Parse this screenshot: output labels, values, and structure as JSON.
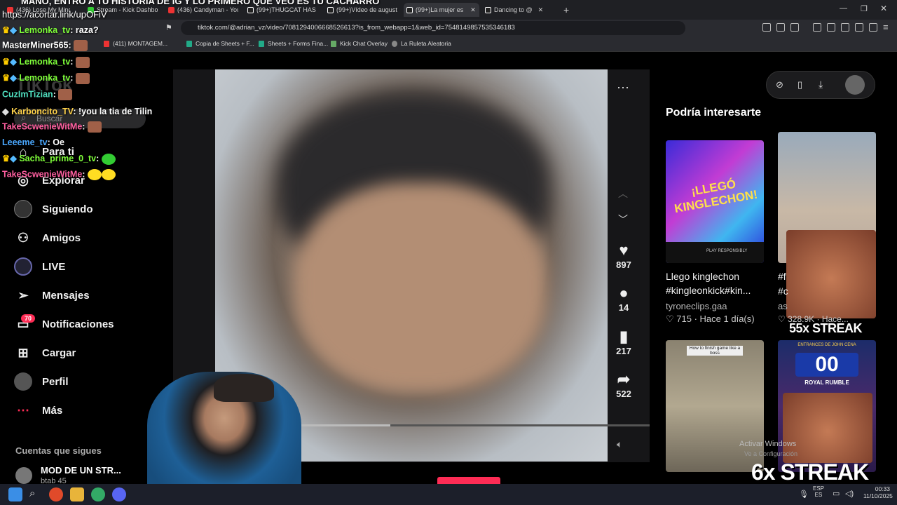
{
  "overlay": {
    "banner": "MANO, ENTRO A TU HISTORIA DE IG Y LO PRIMERO QUE VEO ES TU CACHARRO",
    "link": "https://acortar.link/upOFiV"
  },
  "tabs": [
    {
      "label": "(436) Lose My Mind",
      "color": "#e33"
    },
    {
      "label": "Stream - Kick Dashboa",
      "color": "#3c3"
    },
    {
      "label": "(436) Candyman - You",
      "color": "#e33"
    },
    {
      "label": "(99+)THUGCAT HAS B",
      "color": "#fff"
    },
    {
      "label": "(99+)Vídeo de auguste",
      "color": "#fff"
    },
    {
      "label": "(99+)La mujer es",
      "color": "#fff"
    },
    {
      "label": "Dancing to @",
      "color": "#fff"
    }
  ],
  "address": {
    "url": "tiktok.com/@adrian_vz/video/7081294006668526613?is_from_webapp=1&web_id=7548149857535346183"
  },
  "bookmarks": [
    {
      "label": "(411) MONTAGEM...",
      "color": "#e33"
    },
    {
      "label": "Copia de Sheets + F...",
      "color": "#2a8"
    },
    {
      "label": "Sheets + Forms Fina...",
      "color": "#2a8"
    },
    {
      "label": "Kick Chat Overlay",
      "color": "#6a6"
    },
    {
      "label": "La Ruleta Aleatoria",
      "color": "#888"
    }
  ],
  "sidebar": {
    "logo": "TikTok",
    "search_placeholder": "Buscar",
    "items": [
      {
        "label": "Para ti",
        "icon": "home-icon"
      },
      {
        "label": "Explorar",
        "icon": "compass-icon"
      },
      {
        "label": "Siguiendo",
        "icon": "avatar-icon"
      },
      {
        "label": "Amigos",
        "icon": "friends-icon"
      },
      {
        "label": "LIVE",
        "icon": "live-icon"
      },
      {
        "label": "Mensajes",
        "icon": "send-icon"
      },
      {
        "label": "Notificaciones",
        "icon": "inbox-icon",
        "badge": "70"
      },
      {
        "label": "Cargar",
        "icon": "plus-square-icon"
      },
      {
        "label": "Perfil",
        "icon": "profile-icon"
      },
      {
        "label": "Más",
        "icon": "more-icon"
      }
    ],
    "following_title": "Cuentas que sigues",
    "following": [
      {
        "name": "MOD DE UN STR...",
        "handle": "btab 45"
      }
    ]
  },
  "video": {
    "actions": {
      "likes": "897",
      "comments": "14",
      "saves": "217",
      "shares": "522"
    }
  },
  "recommendations": {
    "title": "Podría interesarte",
    "cards": [
      {
        "title": "Llego kinglechon #kingleonkick#kin...",
        "author": "tyroneclips.gaa",
        "likes": "715",
        "time": "Hace 1 día(s)"
      },
      {
        "title": "#f",
        "line2": "#c",
        "author": "as",
        "likes": "328.9K",
        "time": "Hace..."
      }
    ],
    "thumb1_text": "¡LLEGÓ KINGLECHON!",
    "thumb1_sub": "PLAY RESPONSIBLY",
    "thumb3_text": "How to finish game like a boss",
    "thumb4_text": "ROYAL RUMBLE",
    "thumb4_top": "ENTRANCES DE JOHN CENA"
  },
  "streaks": {
    "top": "55x STREAK",
    "bottom": "6x STREAK"
  },
  "watermark": "Activar Windows",
  "watermark2": "Ve a Configuración",
  "chat": [
    {
      "user": "Lemonka_tv",
      "msg": " raza?",
      "color": "#7fff3a"
    },
    {
      "user": "MasterMiner565",
      "msg": "",
      "color": "#ffffff"
    },
    {
      "user": "Lemonka_tv",
      "msg": "",
      "color": "#7fff3a"
    },
    {
      "user": "Lemonka_tv",
      "msg": "",
      "color": "#7fff3a"
    },
    {
      "user": "CuzImTizian",
      "msg": "",
      "color": "#50e0c0"
    },
    {
      "user": "Karboncito_TV",
      "msg": " !you la tia de Tilin",
      "color": "#ffd24a"
    },
    {
      "user": "TakeScwenieWitMe",
      "msg": "",
      "color": "#ff5fa0"
    },
    {
      "user": "Leeeme_tv",
      "msg": " Oe",
      "color": "#4aa8ff"
    },
    {
      "user": "Sacha_prime_0_tv",
      "msg": "",
      "color": "#7fff3a"
    },
    {
      "user": "TakeScwenieWitMe",
      "msg": "",
      "color": "#ff5fa0"
    }
  ],
  "taskbar": {
    "lang": "ESP",
    "lang2": "ES",
    "time": "00:33",
    "date": "11/10/2025"
  }
}
